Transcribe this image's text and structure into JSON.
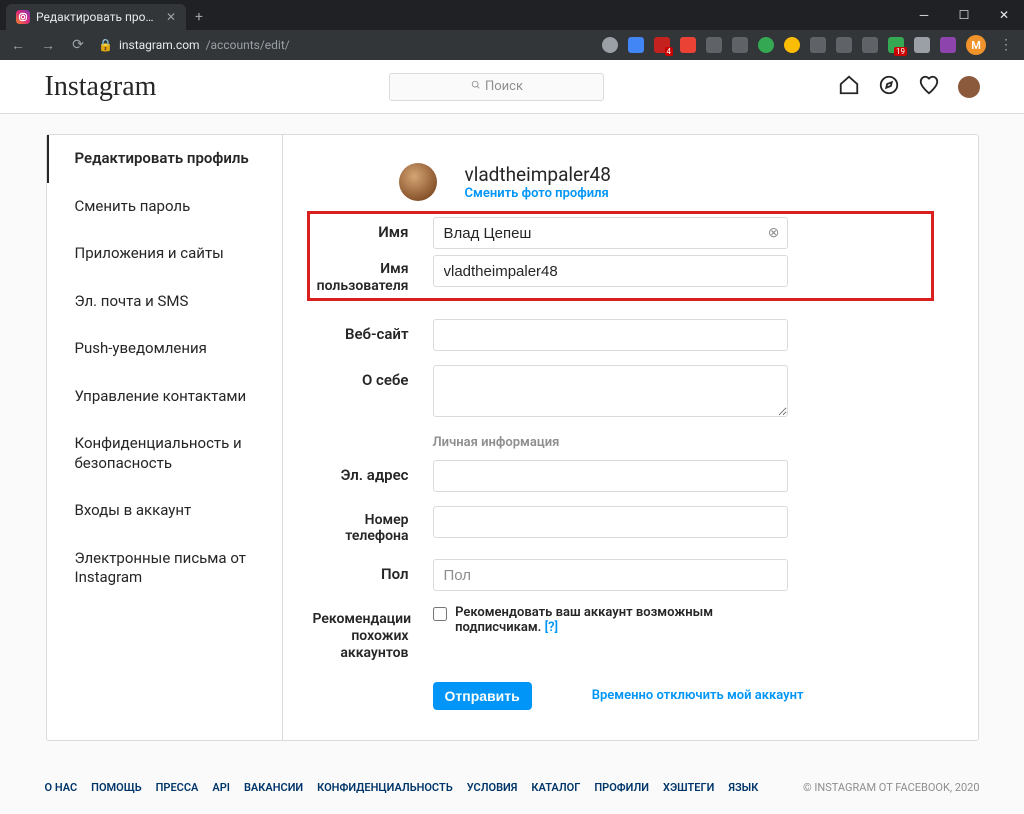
{
  "browser": {
    "tab_title": "Редактировать профиль • Inst",
    "url_host": "instagram.com",
    "url_path": "/accounts/edit/",
    "avatar_letter": "M",
    "ext_badges": [
      "4",
      "19"
    ]
  },
  "header": {
    "logo": "Instagram",
    "search_placeholder": "Поиск"
  },
  "sidebar": {
    "items": [
      "Редактировать профиль",
      "Сменить пароль",
      "Приложения и сайты",
      "Эл. почта и SMS",
      "Push-уведомления",
      "Управление контактами",
      "Конфиденциальность и безопасность",
      "Входы в аккаунт",
      "Электронные письма от Instagram"
    ]
  },
  "profile": {
    "username": "vladtheimpaler48",
    "change_photo": "Сменить фото профиля"
  },
  "form": {
    "name_label": "Имя",
    "name_value": "Влад Цепеш",
    "username_label": "Имя пользователя",
    "username_value": "vladtheimpaler48",
    "website_label": "Веб-сайт",
    "bio_label": "О себе",
    "section_personal": "Личная информация",
    "email_label": "Эл. адрес",
    "phone_label": "Номер телефона",
    "gender_label": "Пол",
    "gender_placeholder": "Пол",
    "rec_label": "Рекомендации похожих аккаунтов",
    "rec_text": "Рекомендовать ваш аккаунт возможным подписчикам.",
    "rec_q": "[?]",
    "submit": "Отправить",
    "disable_link": "Временно отключить мой аккаунт"
  },
  "footer": {
    "links": [
      "О НАС",
      "ПОМОЩЬ",
      "ПРЕССА",
      "API",
      "ВАКАНСИИ",
      "КОНФИДЕНЦИАЛЬНОСТЬ",
      "УСЛОВИЯ",
      "КАТАЛОГ",
      "ПРОФИЛИ",
      "ХЭШТЕГИ",
      "ЯЗЫК"
    ],
    "copyright": "© INSTAGRAM ОТ FACEBOOK, 2020"
  }
}
